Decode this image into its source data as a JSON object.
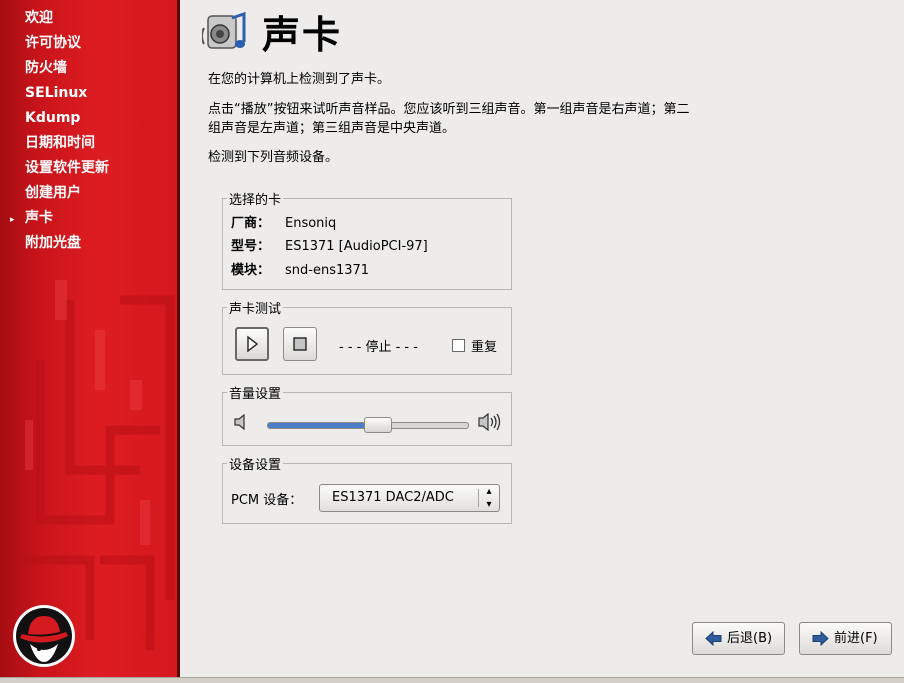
{
  "sidebar": {
    "items": [
      {
        "label": "欢迎"
      },
      {
        "label": "许可协议"
      },
      {
        "label": "防火墙"
      },
      {
        "label": "SELinux"
      },
      {
        "label": "Kdump"
      },
      {
        "label": "日期和时间"
      },
      {
        "label": "设置软件更新"
      },
      {
        "label": "创建用户"
      },
      {
        "label": "声卡",
        "current": true
      },
      {
        "label": "附加光盘"
      }
    ],
    "current_marker": "▸"
  },
  "page": {
    "title": "声卡",
    "title_icon": "sound-card-icon",
    "detected_text": "在您的计算机上检测到了声卡。",
    "instructions_line1": "点击“播放”按钮来试听声音样品。您应该听到三组声音。第一组声音是右声道；第二",
    "instructions_line2": "组声音是左声道；第三组声音是中央声道。",
    "devices_text": "检测到下列音频设备。"
  },
  "selected_card": {
    "legend": "选择的卡",
    "vendor_label": "厂商：",
    "vendor_value": "Ensoniq",
    "model_label": "型号：",
    "model_value": "ES1371 [AudioPCI-97]",
    "module_label": "模块：",
    "module_value": "snd-ens1371"
  },
  "sound_test": {
    "legend": "声卡测试",
    "status": "- - -  停止 - - -",
    "repeat_label": "重复",
    "repeat_checked": false
  },
  "volume": {
    "legend": "音量设置",
    "level": 0.55
  },
  "device": {
    "legend": "设备设置",
    "pcm_label": "PCM 设备：",
    "pcm_value": "ES1371 DAC2/ADC"
  },
  "footer": {
    "back_label": "后退(B)",
    "forward_label": "前进(F)"
  },
  "colors": {
    "sidebar_red": "#d41a1f",
    "background": "#edeceb",
    "slider_fill": "#4b7ec7"
  }
}
